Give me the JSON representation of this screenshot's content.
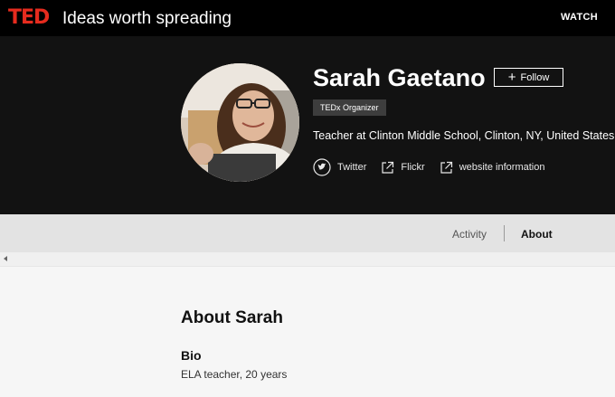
{
  "header": {
    "logo": "TED",
    "tagline": "Ideas worth spreading",
    "watch_label": "WATCH",
    "logo_color": "#e62b1e"
  },
  "profile": {
    "name": "Sarah Gaetano",
    "follow_label": "Follow",
    "badge": "TEDx Organizer",
    "role": "Teacher at Clinton Middle School, Clinton, NY, United States",
    "links": [
      {
        "label": "Twitter",
        "icon": "twitter-icon"
      },
      {
        "label": "Flickr",
        "icon": "external-link-icon"
      },
      {
        "label": "website information",
        "icon": "external-link-icon"
      }
    ]
  },
  "tabs": [
    {
      "label": "Activity",
      "active": false
    },
    {
      "label": "About",
      "active": true
    }
  ],
  "about": {
    "title": "About Sarah",
    "bio_heading": "Bio",
    "bio_text": "ELA teacher, 20 years"
  }
}
